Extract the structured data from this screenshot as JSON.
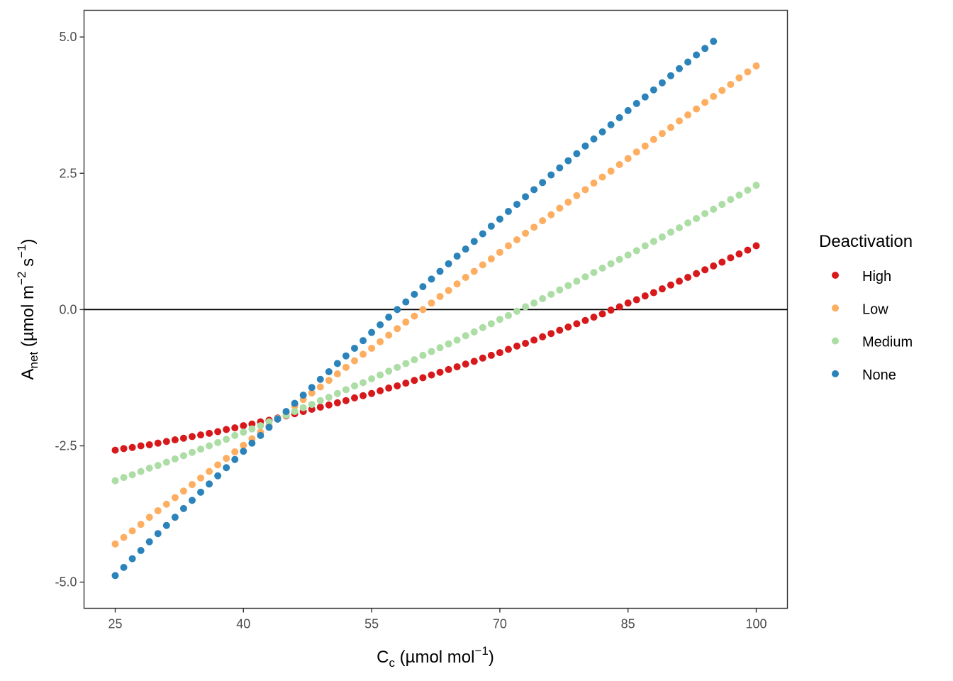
{
  "chart_data": {
    "type": "scatter",
    "title": "",
    "xlabel": {
      "main": "C",
      "sub": "c",
      "rest": " (µmol mol",
      "sup": "−1",
      "close": ")"
    },
    "ylabel": {
      "main": "A",
      "sub": "net",
      "rest": " (µmol m",
      "sup1": "−2",
      "mid": " s",
      "sup2": "−1",
      "close": ")"
    },
    "xlim": [
      21.35,
      103.65
    ],
    "ylim": [
      -5.48,
      5.49
    ],
    "xticks": [
      25,
      40,
      55,
      70,
      85,
      100
    ],
    "xtick_labels": [
      "25",
      "40",
      "55",
      "70",
      "85",
      "100"
    ],
    "yticks": [
      -5.0,
      -2.5,
      0.0,
      2.5,
      5.0
    ],
    "ytick_labels": [
      "-5.0",
      "-2.5",
      "0.0",
      "2.5",
      "5.0"
    ],
    "hline": 0,
    "grid": false,
    "legend": {
      "title": "Deactivation",
      "position": "right"
    },
    "series": [
      {
        "name": "High",
        "color": "#d7191c",
        "x_start": 25,
        "x_step": 1,
        "values": [
          -2.58,
          -2.55,
          -2.53,
          -2.5,
          -2.48,
          -2.45,
          -2.42,
          -2.39,
          -2.36,
          -2.33,
          -2.3,
          -2.27,
          -2.24,
          -2.2,
          -2.17,
          -2.13,
          -2.1,
          -2.06,
          -2.03,
          -1.99,
          -1.95,
          -1.91,
          -1.87,
          -1.83,
          -1.79,
          -1.75,
          -1.71,
          -1.67,
          -1.62,
          -1.58,
          -1.54,
          -1.49,
          -1.44,
          -1.4,
          -1.35,
          -1.3,
          -1.25,
          -1.2,
          -1.15,
          -1.1,
          -1.05,
          -1.0,
          -0.95,
          -0.89,
          -0.84,
          -0.79,
          -0.73,
          -0.67,
          -0.62,
          -0.56,
          -0.5,
          -0.44,
          -0.38,
          -0.32,
          -0.26,
          -0.2,
          -0.14,
          -0.08,
          -0.01,
          0.05,
          0.12,
          0.18,
          0.25,
          0.31,
          0.38,
          0.45,
          0.52,
          0.59,
          0.66,
          0.73,
          0.8,
          0.87,
          0.95,
          1.02,
          1.09,
          1.17
        ]
      },
      {
        "name": "Low",
        "color": "#fdae61",
        "x_start": 25,
        "x_step": 1,
        "values": [
          -4.3,
          -4.18,
          -4.06,
          -3.94,
          -3.81,
          -3.69,
          -3.57,
          -3.45,
          -3.33,
          -3.21,
          -3.09,
          -2.97,
          -2.85,
          -2.73,
          -2.61,
          -2.49,
          -2.37,
          -2.25,
          -2.13,
          -2.01,
          -1.89,
          -1.77,
          -1.65,
          -1.53,
          -1.42,
          -1.3,
          -1.18,
          -1.06,
          -0.94,
          -0.82,
          -0.71,
          -0.59,
          -0.47,
          -0.35,
          -0.23,
          -0.12,
          0.0,
          0.12,
          0.24,
          0.35,
          0.47,
          0.59,
          0.7,
          0.82,
          0.93,
          1.05,
          1.17,
          1.28,
          1.4,
          1.51,
          1.63,
          1.74,
          1.86,
          1.97,
          2.09,
          2.2,
          2.32,
          2.43,
          2.54,
          2.66,
          2.77,
          2.89,
          3.0,
          3.12,
          3.23,
          3.34,
          3.46,
          3.57,
          3.68,
          3.8,
          3.91,
          4.02,
          4.13,
          4.25,
          4.36,
          4.47
        ]
      },
      {
        "name": "Medium",
        "color": "#abdda4",
        "x_start": 25,
        "x_step": 1,
        "values": [
          -3.14,
          -3.08,
          -3.03,
          -2.97,
          -2.91,
          -2.86,
          -2.8,
          -2.74,
          -2.68,
          -2.62,
          -2.56,
          -2.5,
          -2.44,
          -2.38,
          -2.31,
          -2.25,
          -2.19,
          -2.13,
          -2.06,
          -2.0,
          -1.94,
          -1.87,
          -1.8,
          -1.74,
          -1.67,
          -1.61,
          -1.54,
          -1.47,
          -1.4,
          -1.34,
          -1.27,
          -1.2,
          -1.13,
          -1.06,
          -0.99,
          -0.92,
          -0.84,
          -0.77,
          -0.7,
          -0.63,
          -0.56,
          -0.48,
          -0.41,
          -0.33,
          -0.26,
          -0.18,
          -0.11,
          -0.03,
          0.05,
          0.12,
          0.2,
          0.28,
          0.36,
          0.44,
          0.52,
          0.6,
          0.68,
          0.76,
          0.84,
          0.92,
          1.0,
          1.08,
          1.17,
          1.25,
          1.33,
          1.42,
          1.5,
          1.59,
          1.67,
          1.76,
          1.84,
          1.93,
          2.02,
          2.1,
          2.19,
          2.28
        ]
      },
      {
        "name": "None",
        "color": "#2b83ba",
        "x_start": 25,
        "x_step": 1,
        "values": [
          -4.88,
          -4.73,
          -4.57,
          -4.42,
          -4.26,
          -4.11,
          -3.96,
          -3.81,
          -3.65,
          -3.5,
          -3.35,
          -3.2,
          -3.05,
          -2.9,
          -2.75,
          -2.6,
          -2.45,
          -2.31,
          -2.16,
          -2.01,
          -1.87,
          -1.72,
          -1.57,
          -1.43,
          -1.28,
          -1.14,
          -0.99,
          -0.85,
          -0.71,
          -0.57,
          -0.42,
          -0.28,
          -0.14,
          0.0,
          0.14,
          0.28,
          0.42,
          0.56,
          0.7,
          0.84,
          0.98,
          1.11,
          1.25,
          1.39,
          1.53,
          1.66,
          1.8,
          1.93,
          2.07,
          2.2,
          2.33,
          2.47,
          2.6,
          2.73,
          2.86,
          3.0,
          3.13,
          3.26,
          3.39,
          3.52,
          3.65,
          3.78,
          3.9,
          4.03,
          4.16,
          4.29,
          4.42,
          4.54,
          4.67,
          4.79,
          4.92
        ]
      }
    ]
  }
}
